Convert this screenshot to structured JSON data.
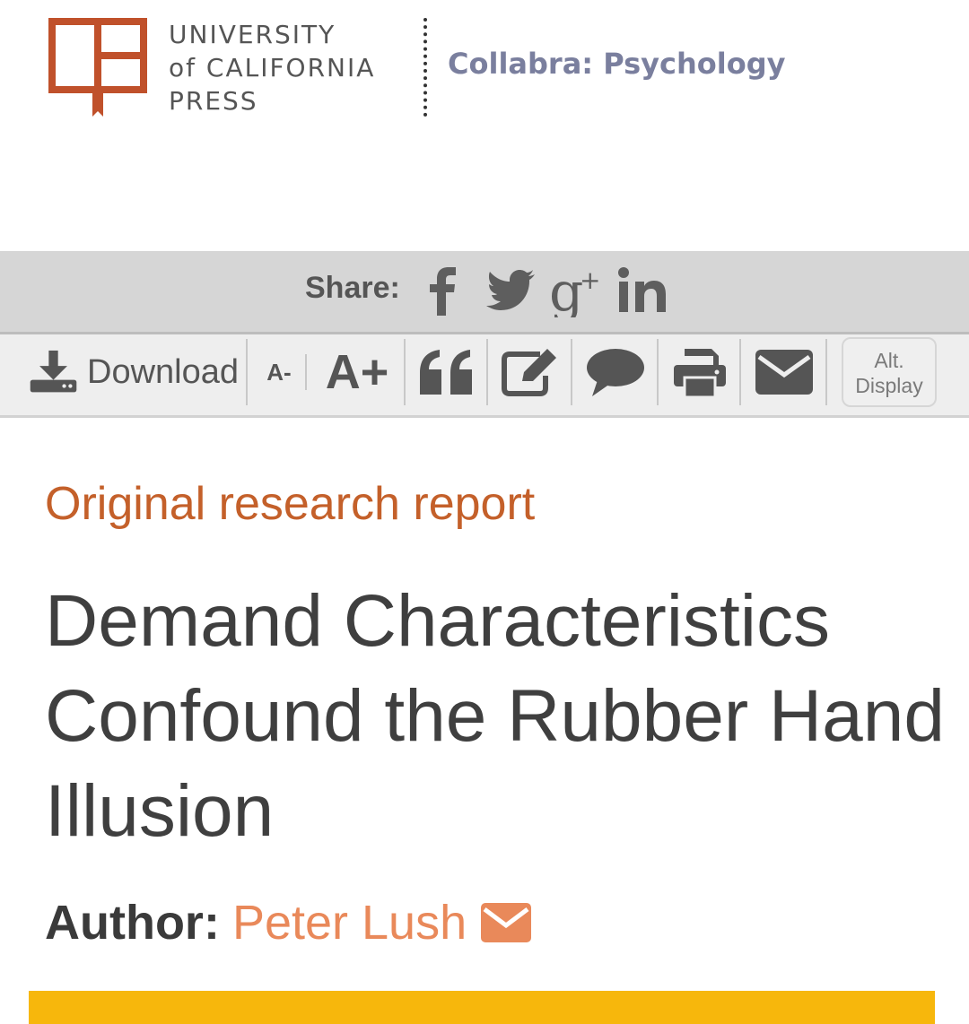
{
  "header": {
    "publisher_lines": [
      "UNIVERSITY",
      "of CALIFORNIA",
      "PRESS"
    ],
    "journal": "Collabra: Psychology"
  },
  "share": {
    "label": "Share:",
    "icons": [
      "facebook-icon",
      "twitter-icon",
      "google-plus-icon",
      "linkedin-icon"
    ]
  },
  "toolbar": {
    "download_label": "Download",
    "font_decrease_label": "A-",
    "font_increase_label": "A+",
    "alt_display_line1": "Alt.",
    "alt_display_line2": "Display",
    "icons": [
      "download-icon",
      "quote-icon",
      "edit-icon",
      "comment-icon",
      "print-icon",
      "email-icon"
    ]
  },
  "article": {
    "type": "Original research report",
    "title": "Demand Characteristics Confound the Rubber Hand Illusion",
    "author_label": "Author:",
    "author_name": "Peter Lush"
  },
  "colors": {
    "logo": "#c0512b",
    "journal": "#7a7f9e",
    "article_type": "#c4602a",
    "author_name": "#e9895a",
    "banner": "#f7b70c"
  }
}
